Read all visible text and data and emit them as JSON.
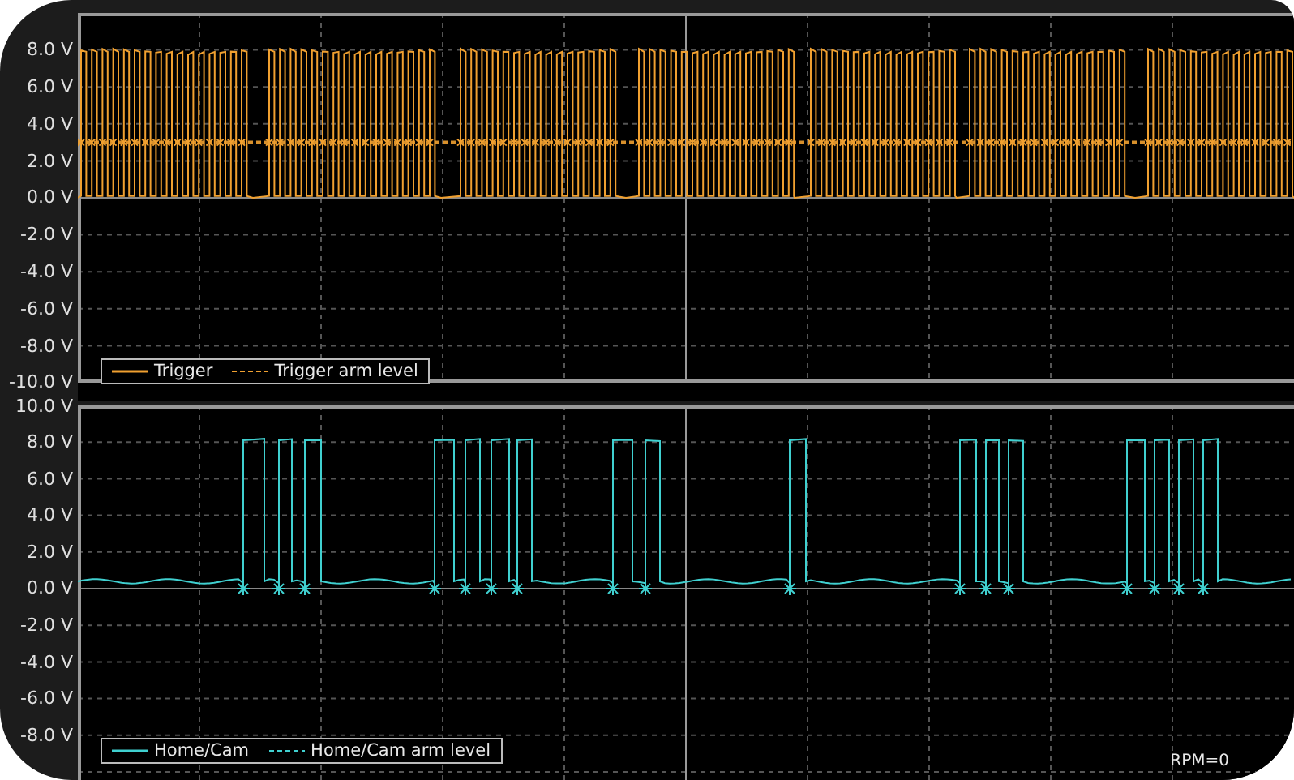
{
  "panels": [
    {
      "kind": "dense-pulses",
      "y_ticks": [
        "8.0 V",
        "6.0 V",
        "4.0 V",
        "2.0 V",
        "0.0 V",
        "-2.0 V",
        "-4.0 V",
        "-6.0 V",
        "-8.0 V",
        "-10.0 V"
      ],
      "legend": [
        {
          "kind": "trace",
          "label": "Trigger",
          "color": "#f0a030"
        },
        {
          "kind": "arm-level",
          "label": "Trigger arm level",
          "color": "#f0a030"
        }
      ]
    },
    {
      "kind": "sparse-pulses",
      "y_ticks": [
        "10.0 V",
        "8.0 V",
        "6.0 V",
        "4.0 V",
        "2.0 V",
        "0.0 V",
        "-2.0 V",
        "-4.0 V",
        "-6.0 V",
        "-8.0 V"
      ],
      "legend": [
        {
          "kind": "trace",
          "label": "Home/Cam",
          "color": "#40d0d0"
        },
        {
          "kind": "arm-level",
          "label": "Home/Cam arm level",
          "color": "#40d0d0"
        }
      ]
    }
  ],
  "rpm": "RPM=0"
}
